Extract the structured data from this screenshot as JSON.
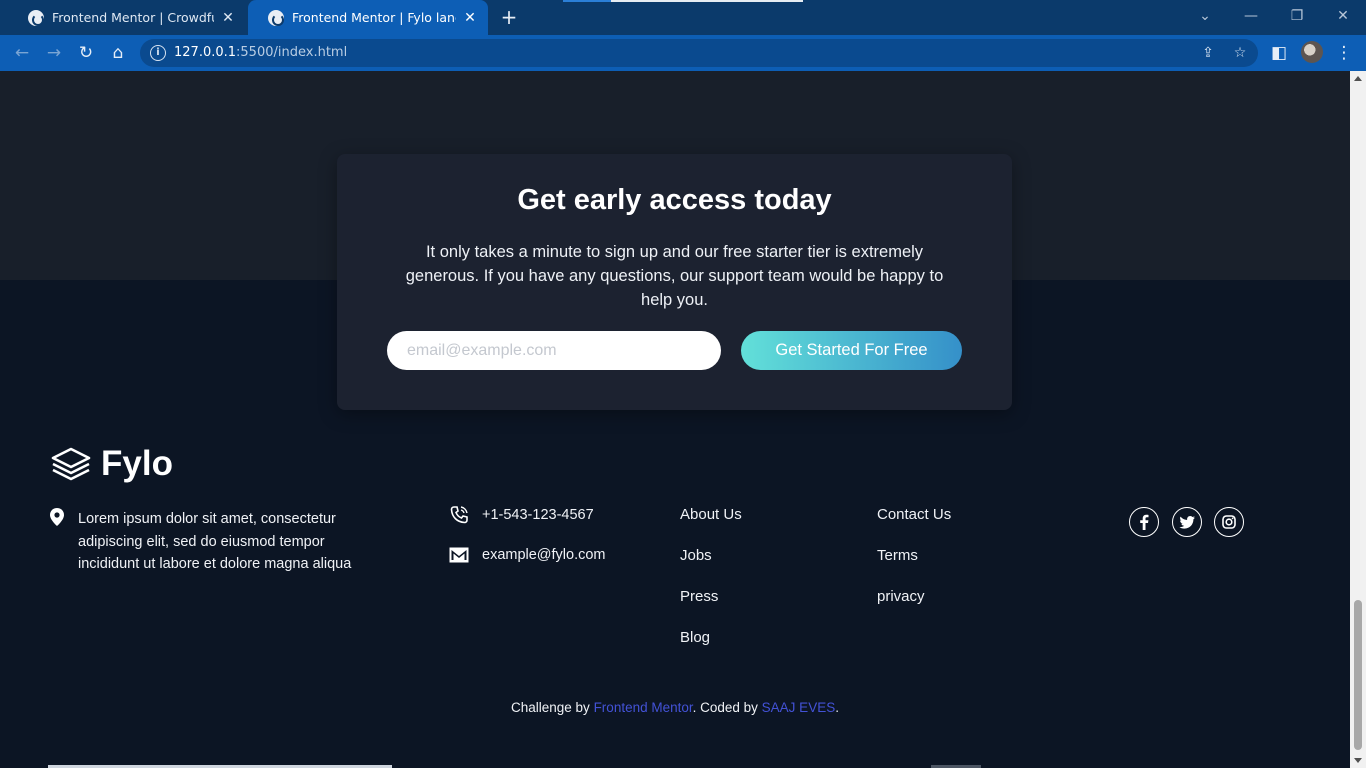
{
  "browser": {
    "tabs": [
      {
        "title": "Frontend Mentor | Crowdfunding",
        "active": false
      },
      {
        "title": "Frontend Mentor | Fylo landing p",
        "active": true
      }
    ],
    "url_host": "127.0.0.1",
    "url_rest": ":5500/index.html",
    "colors": {
      "tabbar": "#0b3a6b",
      "toolbar": "#0d5eb5"
    }
  },
  "cta": {
    "title": "Get early access today",
    "text": "It only takes a minute to sign up and our free starter tier is extremely generous. If you have any questions, our support team would be happy to help you.",
    "email_placeholder": "email@example.com",
    "button_label": "Get Started For Free",
    "colors": {
      "card": "#1c2230",
      "gradient_start": "#62e0d9",
      "gradient_end": "#3590c9"
    }
  },
  "footer": {
    "brand": "Fylo",
    "address": "Lorem ipsum dolor sit amet, consectetur adipiscing elit, sed do eiusmod tempor incididunt ut labore et dolore magna aliqua",
    "phone": "+1-543-123-4567",
    "email": "example@fylo.com",
    "links_col1": [
      "About Us",
      "Jobs",
      "Press",
      "Blog"
    ],
    "links_col2": [
      "Contact Us",
      "Terms",
      "privacy"
    ],
    "social": [
      "facebook-icon",
      "twitter-icon",
      "instagram-icon"
    ],
    "attribution": {
      "prefix": "Challenge by ",
      "link1": "Frontend Mentor",
      "middle": ". Coded by ",
      "link2": "SAAJ EVES",
      "suffix": "."
    },
    "colors": {
      "background": "#0c1524",
      "upper_band": "#181f2a",
      "attribution_link": "#4352d6"
    }
  }
}
